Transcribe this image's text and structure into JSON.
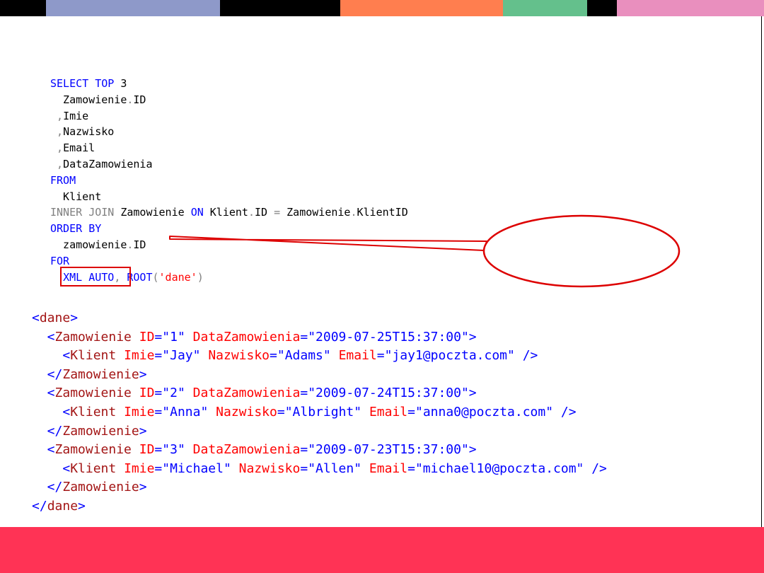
{
  "colors": {
    "top_bar": [
      "#000000",
      "#8e99c9",
      "#000000",
      "#ff7e4f",
      "#64c08c",
      "#000000",
      "#e98fbe"
    ],
    "bottom_bar": "#ff3355",
    "highlight": "#dd0000"
  },
  "sql_lines": [
    [
      {
        "t": "SELECT",
        "c": "kw"
      },
      {
        "t": " ",
        "c": "plain"
      },
      {
        "t": "TOP",
        "c": "kw"
      },
      {
        "t": " 3",
        "c": "plain"
      }
    ],
    [
      {
        "t": "  Zamowienie",
        "c": "plain"
      },
      {
        "t": ".",
        "c": "gray"
      },
      {
        "t": "ID",
        "c": "plain"
      }
    ],
    [
      {
        "t": " ,",
        "c": "gray"
      },
      {
        "t": "Imie",
        "c": "plain"
      }
    ],
    [
      {
        "t": " ,",
        "c": "gray"
      },
      {
        "t": "Nazwisko",
        "c": "plain"
      }
    ],
    [
      {
        "t": " ,",
        "c": "gray"
      },
      {
        "t": "Email",
        "c": "plain"
      }
    ],
    [
      {
        "t": " ,",
        "c": "gray"
      },
      {
        "t": "DataZamowienia",
        "c": "plain"
      }
    ],
    [
      {
        "t": "FROM",
        "c": "kw"
      }
    ],
    [
      {
        "t": "  Klient",
        "c": "plain"
      }
    ],
    [
      {
        "t": "INNER",
        "c": "gray"
      },
      {
        "t": " ",
        "c": "plain"
      },
      {
        "t": "JOIN",
        "c": "gray"
      },
      {
        "t": " Zamowienie ",
        "c": "plain"
      },
      {
        "t": "ON",
        "c": "kw"
      },
      {
        "t": " Klient",
        "c": "plain"
      },
      {
        "t": ".",
        "c": "gray"
      },
      {
        "t": "ID ",
        "c": "plain"
      },
      {
        "t": "=",
        "c": "gray"
      },
      {
        "t": " Zamowienie",
        "c": "plain"
      },
      {
        "t": ".",
        "c": "gray"
      },
      {
        "t": "KlientID",
        "c": "plain"
      }
    ],
    [
      {
        "t": "ORDER",
        "c": "kw"
      },
      {
        "t": " ",
        "c": "plain"
      },
      {
        "t": "BY",
        "c": "kw"
      }
    ],
    [
      {
        "t": "  zamowienie",
        "c": "plain"
      },
      {
        "t": ".",
        "c": "gray"
      },
      {
        "t": "ID",
        "c": "plain"
      }
    ],
    [
      {
        "t": "FOR",
        "c": "kw"
      }
    ],
    [
      {
        "t": "  ",
        "c": "plain"
      },
      {
        "t": "XML",
        "c": "kw"
      },
      {
        "t": " ",
        "c": "plain"
      },
      {
        "t": "AUTO",
        "c": "kw"
      },
      {
        "t": ",",
        "c": "gray"
      },
      {
        "t": " ",
        "c": "plain"
      },
      {
        "t": "ROOT",
        "c": "kw"
      },
      {
        "t": "(",
        "c": "gray"
      },
      {
        "t": "'dane'",
        "c": "str"
      },
      {
        "t": ")",
        "c": "gray"
      }
    ]
  ],
  "xml_lines": [
    [
      {
        "t": "<",
        "c": "pun"
      },
      {
        "t": "dane",
        "c": "name"
      },
      {
        "t": ">",
        "c": "pun"
      }
    ],
    [
      {
        "t": "  <",
        "c": "pun"
      },
      {
        "t": "Zamowienie",
        "c": "name"
      },
      {
        "t": " ",
        "c": "txt"
      },
      {
        "t": "ID",
        "c": "attr"
      },
      {
        "t": "=\"",
        "c": "pun"
      },
      {
        "t": "1",
        "c": "val"
      },
      {
        "t": "\"",
        "c": "pun"
      },
      {
        "t": " ",
        "c": "txt"
      },
      {
        "t": "DataZamowienia",
        "c": "attr"
      },
      {
        "t": "=\"",
        "c": "pun"
      },
      {
        "t": "2009-07-25T15:37:00",
        "c": "val"
      },
      {
        "t": "\">",
        "c": "pun"
      }
    ],
    [
      {
        "t": "    <",
        "c": "pun"
      },
      {
        "t": "Klient",
        "c": "name"
      },
      {
        "t": " ",
        "c": "txt"
      },
      {
        "t": "Imie",
        "c": "attr"
      },
      {
        "t": "=\"",
        "c": "pun"
      },
      {
        "t": "Jay",
        "c": "val"
      },
      {
        "t": "\"",
        "c": "pun"
      },
      {
        "t": " ",
        "c": "txt"
      },
      {
        "t": "Nazwisko",
        "c": "attr"
      },
      {
        "t": "=\"",
        "c": "pun"
      },
      {
        "t": "Adams",
        "c": "val"
      },
      {
        "t": "\"",
        "c": "pun"
      },
      {
        "t": " ",
        "c": "txt"
      },
      {
        "t": "Email",
        "c": "attr"
      },
      {
        "t": "=\"",
        "c": "pun"
      },
      {
        "t": "jay1@poczta.com",
        "c": "val"
      },
      {
        "t": "\" />",
        "c": "pun"
      }
    ],
    [
      {
        "t": "  </",
        "c": "pun"
      },
      {
        "t": "Zamowienie",
        "c": "name"
      },
      {
        "t": ">",
        "c": "pun"
      }
    ],
    [
      {
        "t": "  <",
        "c": "pun"
      },
      {
        "t": "Zamowienie",
        "c": "name"
      },
      {
        "t": " ",
        "c": "txt"
      },
      {
        "t": "ID",
        "c": "attr"
      },
      {
        "t": "=\"",
        "c": "pun"
      },
      {
        "t": "2",
        "c": "val"
      },
      {
        "t": "\"",
        "c": "pun"
      },
      {
        "t": " ",
        "c": "txt"
      },
      {
        "t": "DataZamowienia",
        "c": "attr"
      },
      {
        "t": "=\"",
        "c": "pun"
      },
      {
        "t": "2009-07-24T15:37:00",
        "c": "val"
      },
      {
        "t": "\">",
        "c": "pun"
      }
    ],
    [
      {
        "t": "    <",
        "c": "pun"
      },
      {
        "t": "Klient",
        "c": "name"
      },
      {
        "t": " ",
        "c": "txt"
      },
      {
        "t": "Imie",
        "c": "attr"
      },
      {
        "t": "=\"",
        "c": "pun"
      },
      {
        "t": "Anna",
        "c": "val"
      },
      {
        "t": "\"",
        "c": "pun"
      },
      {
        "t": " ",
        "c": "txt"
      },
      {
        "t": "Nazwisko",
        "c": "attr"
      },
      {
        "t": "=\"",
        "c": "pun"
      },
      {
        "t": "Albright",
        "c": "val"
      },
      {
        "t": "\"",
        "c": "pun"
      },
      {
        "t": " ",
        "c": "txt"
      },
      {
        "t": "Email",
        "c": "attr"
      },
      {
        "t": "=\"",
        "c": "pun"
      },
      {
        "t": "anna0@poczta.com",
        "c": "val"
      },
      {
        "t": "\" />",
        "c": "pun"
      }
    ],
    [
      {
        "t": "  </",
        "c": "pun"
      },
      {
        "t": "Zamowienie",
        "c": "name"
      },
      {
        "t": ">",
        "c": "pun"
      }
    ],
    [
      {
        "t": "  <",
        "c": "pun"
      },
      {
        "t": "Zamowienie",
        "c": "name"
      },
      {
        "t": " ",
        "c": "txt"
      },
      {
        "t": "ID",
        "c": "attr"
      },
      {
        "t": "=\"",
        "c": "pun"
      },
      {
        "t": "3",
        "c": "val"
      },
      {
        "t": "\"",
        "c": "pun"
      },
      {
        "t": " ",
        "c": "txt"
      },
      {
        "t": "DataZamowienia",
        "c": "attr"
      },
      {
        "t": "=\"",
        "c": "pun"
      },
      {
        "t": "2009-07-23T15:37:00",
        "c": "val"
      },
      {
        "t": "\">",
        "c": "pun"
      }
    ],
    [
      {
        "t": "    <",
        "c": "pun"
      },
      {
        "t": "Klient",
        "c": "name"
      },
      {
        "t": " ",
        "c": "txt"
      },
      {
        "t": "Imie",
        "c": "attr"
      },
      {
        "t": "=\"",
        "c": "pun"
      },
      {
        "t": "Michael",
        "c": "val"
      },
      {
        "t": "\"",
        "c": "pun"
      },
      {
        "t": " ",
        "c": "txt"
      },
      {
        "t": "Nazwisko",
        "c": "attr"
      },
      {
        "t": "=\"",
        "c": "pun"
      },
      {
        "t": "Allen",
        "c": "val"
      },
      {
        "t": "\"",
        "c": "pun"
      },
      {
        "t": " ",
        "c": "txt"
      },
      {
        "t": "Email",
        "c": "attr"
      },
      {
        "t": "=\"",
        "c": "pun"
      },
      {
        "t": "michael10@poczta.com",
        "c": "val"
      },
      {
        "t": "\" />",
        "c": "pun"
      }
    ],
    [
      {
        "t": "  </",
        "c": "pun"
      },
      {
        "t": "Zamowienie",
        "c": "name"
      },
      {
        "t": ">",
        "c": "pun"
      }
    ],
    [
      {
        "t": "</",
        "c": "pun"
      },
      {
        "t": "dane",
        "c": "name"
      },
      {
        "t": ">",
        "c": "pun"
      }
    ]
  ]
}
